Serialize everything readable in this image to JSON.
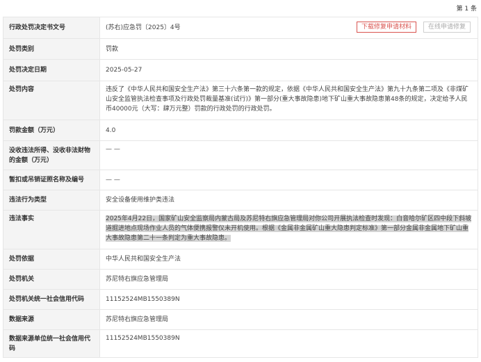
{
  "page_count": "第 1 条",
  "record": {
    "doc_no_label": "行政处罚决定书文号",
    "doc_no_value": "(苏右)应急罚〔2025〕4号",
    "download_btn": "下载修复申请材料",
    "online_btn": "在线申请修复",
    "type_label": "处罚类别",
    "type_value": "罚款",
    "date_label": "处罚决定日期",
    "date_value": "2025-05-27",
    "content_label": "处罚内容",
    "content_value": "违反了《中华人民共和国安全生产法》第三十六条第一款的规定，依据《中华人民共和国安全生产法》第九十九条第二项及《非煤矿山安全监管执法检查事项及行政处罚裁量基准(试行)》第一部分(重大事故隐患)地下矿山重大事故隐患第48条的规定，决定给予人民币40000元（大写：肆万元整）罚款的行政处罚的行政处罚。",
    "amount_label": "罚款金额（万元）",
    "amount_value": "4.0",
    "confiscate_label": "没收违法所得、没收非法财物的金额（万元）",
    "confiscate_value": "— —",
    "license_label": "暂扣或吊销证照名称及编号",
    "license_value": "— —",
    "behavior_label": "违法行为类型",
    "behavior_value": "安全设备使用维护类违法",
    "facts_label": "违法事实",
    "facts_value": "2025年4月22日，国家矿山安全监察局内蒙古局及苏尼特右旗应急管理局对你公司开展执法检查时发现：白音哈尔矿区四中段下斜坡道掘进地点现场作业人员的气体便携报警仪未开机使用。根据《金属非金属矿山重大隐患判定标准》第一部分金属非金属地下矿山重大事故隐患第二十一条判定为重大事故隐患。",
    "basis_label": "处罚依据",
    "basis_value": "中华人民共和国安全生产法",
    "authority_label": "处罚机关",
    "authority_value": "苏尼特右旗应急管理局",
    "authority_code_label": "处罚机关统一社会信用代码",
    "authority_code_value": "11152524MB1550389N",
    "source_label": "数据来源",
    "source_value": "苏尼特右旗应急管理局",
    "source_code_label": "数据来源单位统一社会信用代码",
    "source_code_value": "11152524MB1550389N"
  }
}
